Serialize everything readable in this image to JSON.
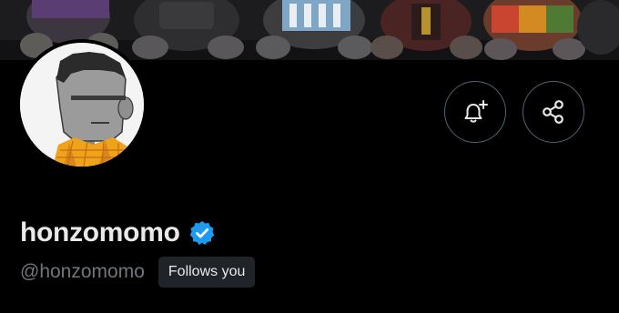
{
  "profile": {
    "display_name": "honzomomo",
    "handle": "@honzomomo",
    "follows_you_label": "Follows you",
    "verified": true
  },
  "actions": {
    "notify_icon": "bell-plus-icon",
    "share_icon": "share-icon"
  },
  "colors": {
    "background": "#000000",
    "primary_text": "#e7e9ea",
    "secondary_text": "#71767b",
    "verified_blue": "#1d9bf0",
    "button_border": "#536471",
    "badge_background": "#202327"
  }
}
